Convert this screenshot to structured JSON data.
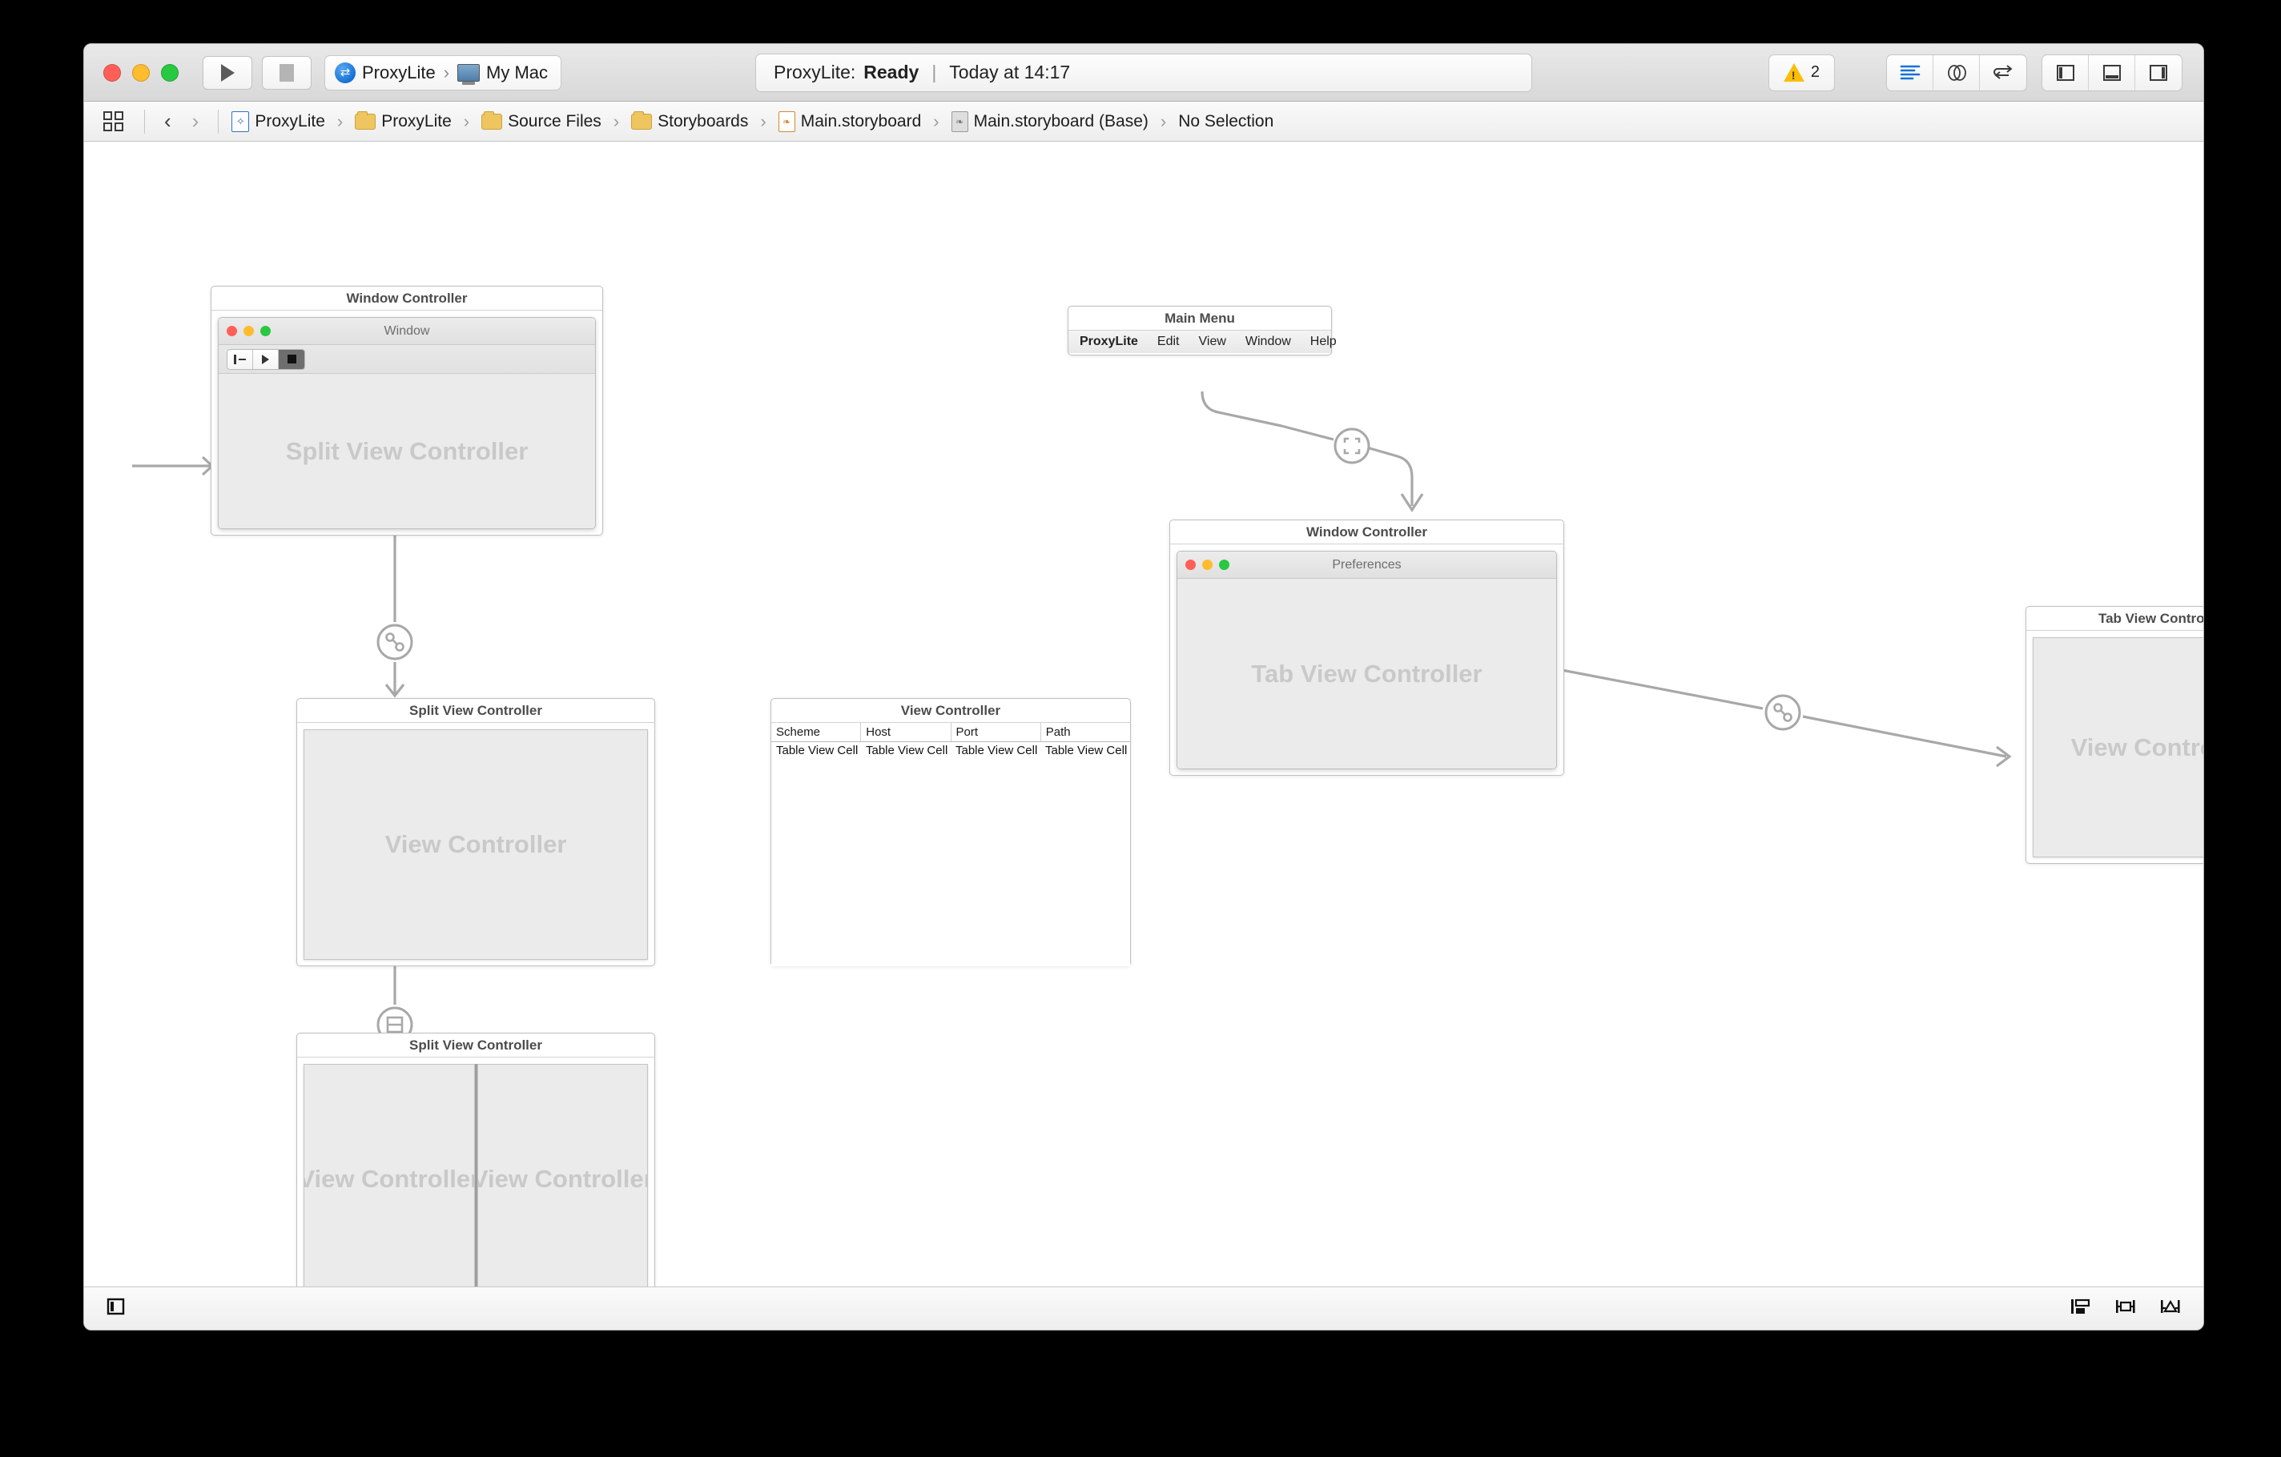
{
  "window": {
    "traffic_lights": [
      "close",
      "minimize",
      "zoom"
    ]
  },
  "toolbar": {
    "run_button": "run-icon",
    "stop_button": "stop-icon",
    "scheme_name": "ProxyLite",
    "destination_name": "My Mac",
    "status": {
      "prefix": "ProxyLite:",
      "state": "Ready",
      "separator": "|",
      "time": "Today at 14:17"
    },
    "warning_count": "2",
    "editor_buttons": [
      "standard-editor-icon",
      "assistant-editor-icon",
      "version-editor-icon"
    ],
    "panel_buttons": [
      "toggle-navigator-icon",
      "toggle-debug-area-icon",
      "toggle-utilities-icon"
    ]
  },
  "jumpbar": {
    "grid_button": "related-items-icon",
    "back_label": "‹",
    "forward_label": "›",
    "separator": "›",
    "crumbs": [
      {
        "label": "ProxyLite",
        "icon": "xcode-project-icon"
      },
      {
        "label": "ProxyLite",
        "icon": "folder-icon"
      },
      {
        "label": "Source Files",
        "icon": "folder-icon"
      },
      {
        "label": "Storyboards",
        "icon": "folder-icon"
      },
      {
        "label": "Main.storyboard",
        "icon": "storyboard-file-icon"
      },
      {
        "label": "Main.storyboard (Base)",
        "icon": "storyboard-base-icon"
      },
      {
        "label": "No Selection",
        "icon": "none"
      }
    ]
  },
  "canvas": {
    "scenes": {
      "main_window_controller": {
        "title": "Window Controller",
        "window_title": "Window",
        "placeholder": "Split View Controller"
      },
      "main_menu": {
        "title": "Main Menu",
        "items": [
          "ProxyLite",
          "Edit",
          "View",
          "Window",
          "Help"
        ]
      },
      "prefs_window_controller": {
        "title": "Window Controller",
        "window_title": "Preferences",
        "placeholder": "Tab View Controller"
      },
      "tab_view_controller": {
        "title": "Tab View Controller",
        "placeholder": "View Controller"
      },
      "split_view_controller_1": {
        "title": "Split View Controller",
        "placeholder": "View Controller"
      },
      "table_view_controller": {
        "title": "View Controller",
        "columns": [
          "Scheme",
          "Host",
          "Port",
          "Path"
        ],
        "row": [
          "Table View Cell",
          "Table View Cell",
          "Table View Cell",
          "Table View Cell"
        ]
      },
      "split_view_controller_2": {
        "title": "Split View Controller",
        "left_placeholder": "View Controller",
        "right_placeholder": "View Controller"
      }
    },
    "segues": [
      {
        "name": "relationship-segue",
        "icon": "relationship-icon"
      },
      {
        "name": "present-segue",
        "icon": "present-modally-icon"
      },
      {
        "name": "embed-segue",
        "icon": "embed-icon"
      },
      {
        "name": "split-item-segue",
        "icon": "split-item-icon"
      }
    ],
    "entry_point": "initial-view-controller-arrow"
  },
  "bottombar": {
    "left_buttons": [
      "document-outline-icon"
    ],
    "right_buttons": [
      "align-icon",
      "pin-icon",
      "resolve-issues-icon"
    ]
  },
  "colors": {
    "accent_blue": "#1572d6",
    "warning_yellow": "#fbbd08",
    "placeholder_grey": "#c9c9c9",
    "scene_fill": "#ebebeb",
    "segue_line": "#a8a8a8"
  }
}
